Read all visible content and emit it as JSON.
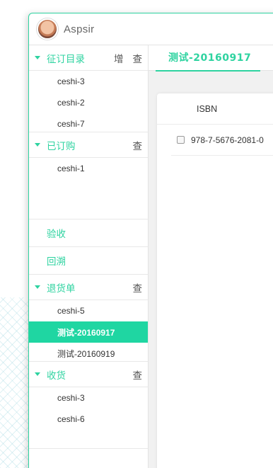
{
  "app": {
    "brand": "Aspsir",
    "avatar_icon": "user-avatar-icon"
  },
  "sidebar": {
    "sections": [
      {
        "title": "征订目录",
        "actions": [
          "增",
          "查"
        ],
        "items": [
          "ceshi-3",
          "ceshi-2",
          "ceshi-7"
        ]
      },
      {
        "title": "已订购",
        "actions": [
          "查"
        ],
        "items": [
          "ceshi-1"
        ]
      }
    ],
    "links": [
      "验收",
      "回溯"
    ],
    "sections2": [
      {
        "title": "退货单",
        "actions": [
          "查"
        ],
        "items": [
          "ceshi-5",
          "测试-20160917",
          "测试-20160919"
        ],
        "active_index": 1
      },
      {
        "title": "收货",
        "actions": [
          "查"
        ],
        "items": [
          "ceshi-3",
          "ceshi-6"
        ]
      }
    ]
  },
  "main": {
    "active_tab": "测试-20160917",
    "table": {
      "columns": [
        "ISBN"
      ],
      "rows": [
        {
          "isbn": "978-7-5676-2081-0",
          "checked": false
        }
      ]
    }
  },
  "colors": {
    "accent": "#2ed3a0",
    "active_bg": "#1fd6a2",
    "main_bg": "#f1f1f1"
  }
}
